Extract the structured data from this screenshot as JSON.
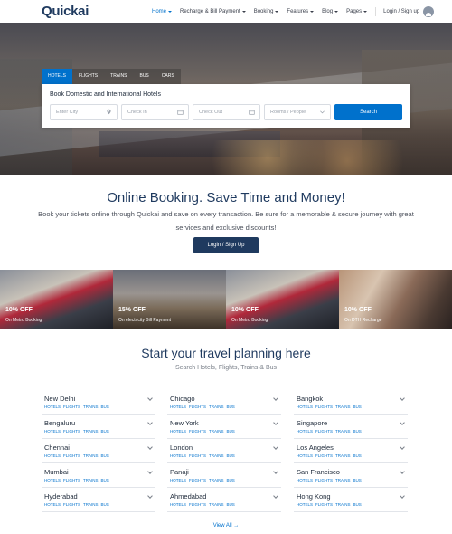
{
  "header": {
    "logo": "Quickai",
    "nav": [
      {
        "label": "Home",
        "active": true
      },
      {
        "label": "Recharge & Bill Payment",
        "active": false
      },
      {
        "label": "Booking",
        "active": false
      },
      {
        "label": "Features",
        "active": false
      },
      {
        "label": "Blog",
        "active": false
      },
      {
        "label": "Pages",
        "active": false
      }
    ],
    "login": "Login / Sign up"
  },
  "search": {
    "tabs": [
      "HOTELS",
      "FLIGHTS",
      "TRAINS",
      "BUS",
      "CARS"
    ],
    "active_tab": "HOTELS",
    "title": "Book Domestic and International Hotels",
    "city_placeholder": "Enter City",
    "checkin_placeholder": "Check In",
    "checkout_placeholder": "Check Out",
    "rooms_placeholder": "Rooms / People",
    "button": "Search"
  },
  "promo": {
    "title": "Online Booking. Save Time and Money!",
    "text": "Book your tickets online through Quickai and save on every transaction. Be sure for a memorable & secure journey with great services and exclusive discounts!",
    "button": "Login / Sign Up"
  },
  "offers": [
    {
      "pct": "10% OFF",
      "sub": "On Metro Booking"
    },
    {
      "pct": "15% OFF",
      "sub": "On electricity Bill Payment"
    },
    {
      "pct": "10% OFF",
      "sub": "On Metro Booking"
    },
    {
      "pct": "10% OFF",
      "sub": "On DTH Recharge"
    }
  ],
  "planning": {
    "title": "Start your travel planning here",
    "subtitle": "Search Hotels, Flights, Trains & Bus",
    "link_labels": [
      "HOTELS",
      "FLIGHTS",
      "TRAINS",
      "BUS"
    ],
    "cities": [
      [
        "New Delhi",
        "Chicago",
        "Bangkok"
      ],
      [
        "Bengaluru",
        "New York",
        "Singapore"
      ],
      [
        "Chennai",
        "London",
        "Los Angeles"
      ],
      [
        "Mumbai",
        "Panaji",
        "San Francisco"
      ],
      [
        "Hyderabad",
        "Ahmedabad",
        "Hong Kong"
      ]
    ],
    "view_all": "View All"
  },
  "colors": {
    "primary": "#0071cc",
    "navy": "#1f3a5f"
  }
}
